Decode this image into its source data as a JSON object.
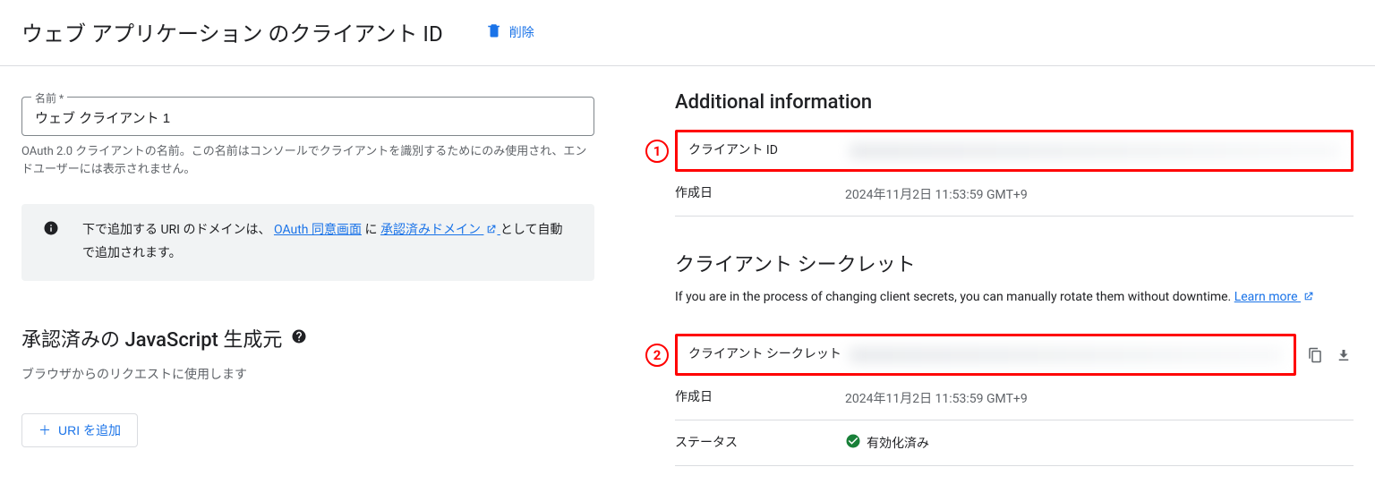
{
  "header": {
    "title": "ウェブ アプリケーション のクライアント ID",
    "delete_label": "削除"
  },
  "name_field": {
    "label": "名前 *",
    "value": "ウェブ クライアント 1",
    "helper": "OAuth 2.0 クライアントの名前。この名前はコンソールでクライアントを識別するためにのみ使用され、エンドユーザーには表示されません。"
  },
  "info": {
    "prefix": "下で追加する URI のドメインは、",
    "link1": "OAuth 同意画面",
    "mid": "に",
    "link2": "承認済みドメイン",
    "suffix": "として自動で追加されます。"
  },
  "js_origins": {
    "title": "承認済みの JavaScript 生成元",
    "subtitle": "ブラウザからのリクエストに使用します",
    "add_label": "URI を追加"
  },
  "additional": {
    "title": "Additional information",
    "client_id_label": "クライアント ID",
    "created_label": "作成日",
    "created_value": "2024年11月2日 11:53:59 GMT+9",
    "callout1": "1"
  },
  "secrets": {
    "title": "クライアント シークレット",
    "desc_prefix": "If you are in the process of changing client secrets, you can manually rotate them without downtime. ",
    "learn_more": "Learn more",
    "secret_label": "クライアント シークレット",
    "created_label": "作成日",
    "created_value": "2024年11月2日 11:53:59 GMT+9",
    "status_label": "ステータス",
    "status_value": "有効化済み",
    "callout2": "2"
  }
}
